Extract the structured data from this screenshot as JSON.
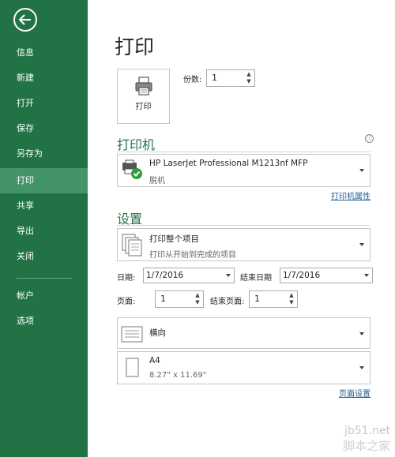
{
  "sidebar": {
    "back_label": "←",
    "items": [
      {
        "label": "信息"
      },
      {
        "label": "新建"
      },
      {
        "label": "打开"
      },
      {
        "label": "保存"
      },
      {
        "label": "另存为"
      },
      {
        "label": "打印",
        "active": true
      },
      {
        "label": "共享"
      },
      {
        "label": "导出"
      },
      {
        "label": "关闭"
      },
      {
        "label": "帐户"
      },
      {
        "label": "选项"
      }
    ]
  },
  "main": {
    "title": "打印",
    "print_button_label": "打印",
    "copies": {
      "label": "份数:",
      "value": "1"
    },
    "printer": {
      "section_title": "打印机",
      "info_icon": "ⓘ",
      "name": "HP LaserJet Professional M1213nf MFP",
      "status": "脱机",
      "properties_link": "打印机属性"
    },
    "settings": {
      "section_title": "设置",
      "scope": {
        "title": "打印整个项目",
        "subtitle": "打印从开始到完成的项目"
      },
      "start_date_label": "日期:",
      "start_date_value": "1/7/2016",
      "end_date_label": "结束日期",
      "end_date_value": "1/7/2016",
      "page_label": "页面:",
      "page_value": "1",
      "end_page_label": "结束页面:",
      "end_page_value": "1",
      "orientation": "横向",
      "paper_size": {
        "name": "A4",
        "dimensions": "8.27\" x 11.69\""
      },
      "page_setup_link": "页面设置"
    }
  },
  "watermark": {
    "line1": "jb51.net",
    "line2": "脚本之家"
  },
  "colors": {
    "accent": "#217346",
    "active_nav": "#439467",
    "link": "#1f5c99"
  }
}
